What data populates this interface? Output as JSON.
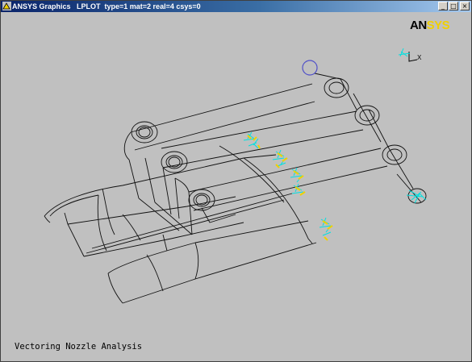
{
  "window": {
    "title": "ANSYS Graphics   LPLOT  type=1 mat=2 real=4 csys=0",
    "controls": {
      "minimize": "_",
      "maximize": "□",
      "close": "×"
    }
  },
  "logo": {
    "part1": "AN",
    "part2": "SYS"
  },
  "triad": {
    "x_label": "X"
  },
  "caption": "Vectoring Nozzle Analysis",
  "colors": {
    "background": "#c0c0c0",
    "titlebar": "#0a246a",
    "wireframe": "#101010",
    "constraint": "#00e0e0",
    "force": "#f0d000",
    "keypoint": "#5050c8"
  }
}
